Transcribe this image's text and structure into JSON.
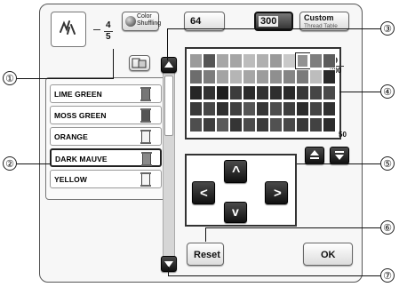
{
  "callouts": [
    "①",
    "②",
    "③",
    "④",
    "⑤",
    "⑥",
    "⑦"
  ],
  "header": {
    "page_current": "4",
    "page_total": "5"
  },
  "buttons": {
    "color_shuffling": "Color\nShuffling",
    "palette_64": "64",
    "palette_300": "300",
    "custom": "Custom",
    "custom_sub": "Thread Table",
    "reset": "Reset",
    "ok": "OK"
  },
  "threads": [
    {
      "name": "LIME GREEN",
      "spool_color": "#777777",
      "selected": false
    },
    {
      "name": "MOSS GREEN",
      "spool_color": "#555555",
      "selected": false
    },
    {
      "name": "ORANGE",
      "spool_color": "#f2f2f2",
      "selected": false
    },
    {
      "name": "DARK MAUVE",
      "spool_color": "#8a8a8a",
      "selected": true
    },
    {
      "name": "YELLOW",
      "spool_color": "#f5f5f5",
      "selected": false
    }
  ],
  "palette_counter": {
    "current": "9",
    "total": "300"
  },
  "palette_side_number": "50",
  "palette_rows": [
    [
      "#9b9b9b",
      "#555555",
      "#a7a7a7",
      "#a5a5a5",
      "#bcbcbc",
      "#b0b0b0",
      "#9a9a9a",
      "#c9c9c9",
      "#929292",
      "#7e7e7e",
      "#5c5c5c"
    ],
    [
      "#6d6d6d",
      "#7d7d7d",
      "#a3a3a3",
      "#b5b5b5",
      "#a6a6a6",
      "#9c9c9c",
      "#8f8f8f",
      "#858585",
      "#7a7a7a",
      "#bdbdbd",
      "#2a2a2a"
    ],
    [
      "#262626",
      "#323232",
      "#1f1f1f",
      "#3c3c3c",
      "#2b2b2b",
      "#333333",
      "#2e2e2e",
      "#2a2a2a",
      "#383838",
      "#454545",
      "#4a4a4a"
    ],
    [
      "#3a3a3a",
      "#474747",
      "#2f2f2f",
      "#404040",
      "#555555",
      "#363636",
      "#4d4d4d",
      "#3f3f3f",
      "#2d2d2d",
      "#444444",
      "#313131"
    ],
    [
      "#4e4e4e",
      "#3d3d3d",
      "#5a5a5a",
      "#353535",
      "#4b4b4b",
      "#3b3b3b",
      "#515151",
      "#484848",
      "#393939",
      "#424242",
      "#2c2c2c"
    ]
  ],
  "arrows": {
    "up": "^",
    "down": "v",
    "left": "<",
    "right": ">"
  },
  "colors": {
    "accent_dark": "#1a1a1a",
    "frame": "#555555"
  }
}
